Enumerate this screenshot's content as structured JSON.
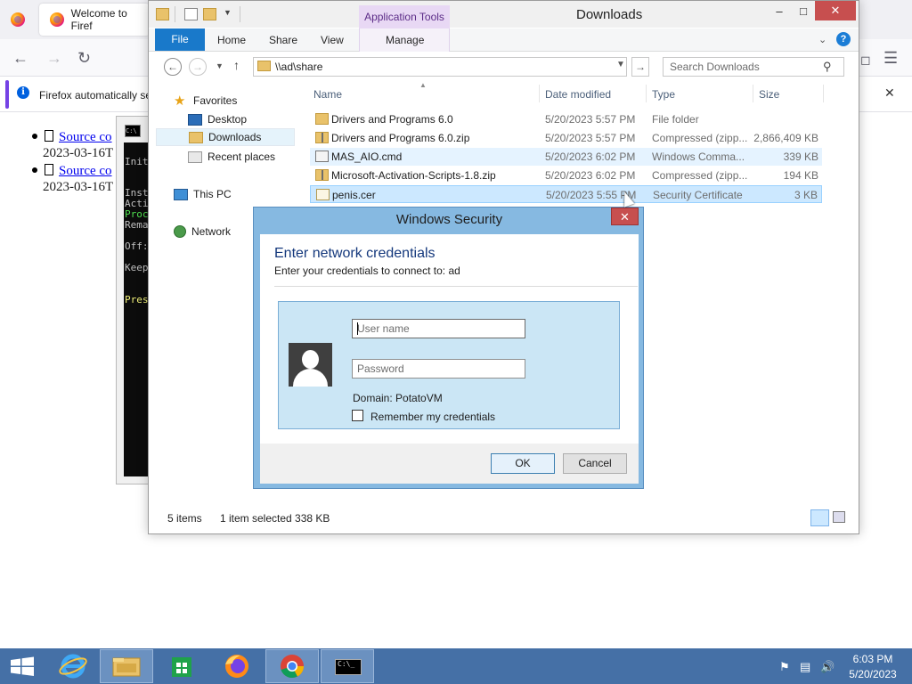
{
  "firefox": {
    "tab_title": "Welcome to Firef",
    "notice_text": "Firefox automatically se",
    "page_lines": [
      {
        "link": "Source co",
        "date": "2023-03-16T"
      },
      {
        "link": "Source co",
        "date": "2023-03-16T"
      }
    ]
  },
  "cmd": {
    "icon_text": "C:\\",
    "lines": [
      "Init",
      "Inst",
      "Acti",
      "Proc",
      "Rema",
      "Off:",
      "Keep",
      "Pres"
    ]
  },
  "explorer": {
    "title": "Downloads",
    "app_tools_label": "Application Tools",
    "ribbon_tabs": [
      "File",
      "Home",
      "Share",
      "View",
      "Manage"
    ],
    "address": "\\\\ad\\share",
    "search_placeholder": "Search Downloads",
    "nav": {
      "favorites": "Favorites",
      "desktop": "Desktop",
      "downloads": "Downloads",
      "recent": "Recent places",
      "this_pc": "This PC",
      "network": "Network"
    },
    "columns": {
      "name": "Name",
      "date": "Date modified",
      "type": "Type",
      "size": "Size"
    },
    "files": [
      {
        "name": "Drivers and Programs 6.0",
        "date": "5/20/2023 5:57 PM",
        "type": "File folder",
        "size": ""
      },
      {
        "name": "Drivers and Programs 6.0.zip",
        "date": "5/20/2023 5:57 PM",
        "type": "Compressed (zipp...",
        "size": "2,866,409 KB"
      },
      {
        "name": "MAS_AIO.cmd",
        "date": "5/20/2023 6:02 PM",
        "type": "Windows Comma...",
        "size": "339 KB"
      },
      {
        "name": "Microsoft-Activation-Scripts-1.8.zip",
        "date": "5/20/2023 6:02 PM",
        "type": "Compressed (zipp...",
        "size": "194 KB"
      },
      {
        "name": "penis.cer",
        "date": "5/20/2023 5:55 PM",
        "type": "Security Certificate",
        "size": "3 KB"
      }
    ],
    "status": {
      "items": "5 items",
      "selected": "1 item selected  338 KB"
    }
  },
  "security": {
    "title": "Windows Security",
    "heading": "Enter network credentials",
    "subtitle": "Enter your credentials to connect to: ad",
    "username_placeholder": "User name",
    "password_placeholder": "Password",
    "domain": "Domain: PotatoVM",
    "remember_label": "Remember my credentials",
    "ok_label": "OK",
    "cancel_label": "Cancel"
  },
  "taskbar": {
    "time": "6:03 PM",
    "date": "5/20/2023",
    "cmd_icon_text": "C:\\_"
  }
}
